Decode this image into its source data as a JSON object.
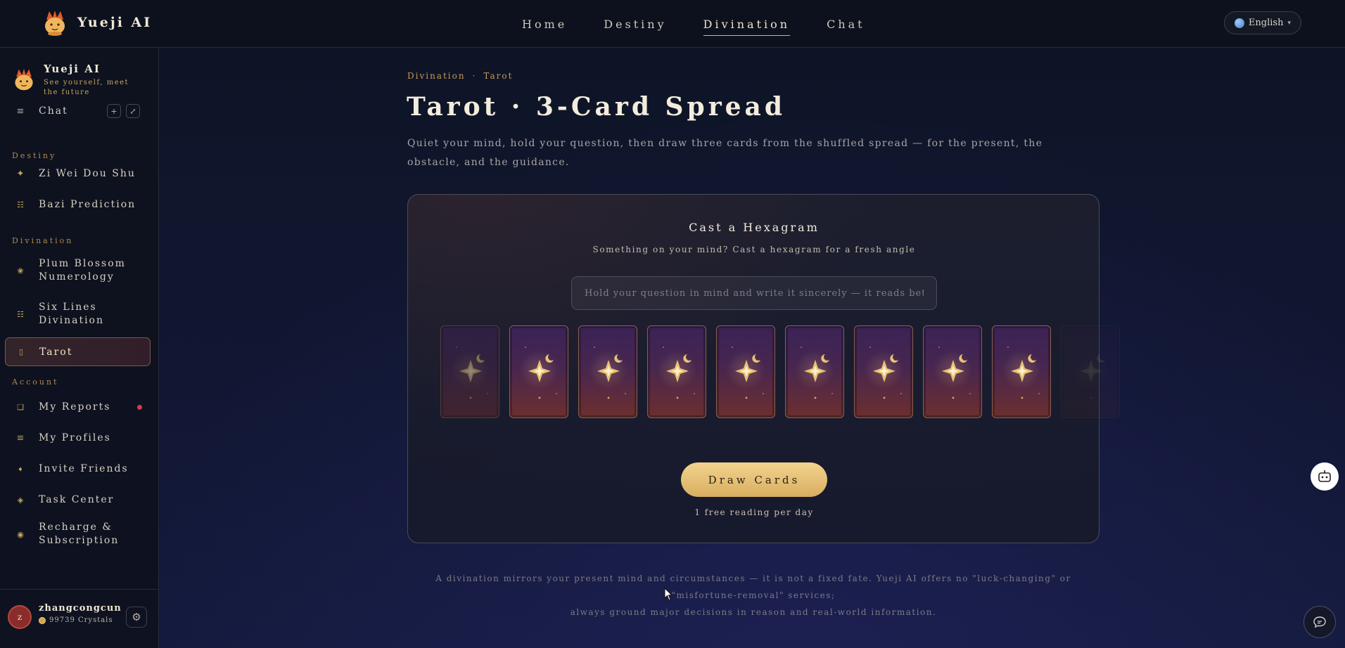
{
  "app": {
    "name": "Yueji AI",
    "tagline": "See yourself, meet the future"
  },
  "topnav": {
    "items": [
      {
        "label": "Home"
      },
      {
        "label": "Destiny"
      },
      {
        "label": "Divination"
      },
      {
        "label": "Chat"
      }
    ],
    "active": "Divination",
    "language": "English"
  },
  "sidebar": {
    "chat_label": "Chat",
    "groups": {
      "destiny": "Destiny",
      "divination": "Divination",
      "account": "Account"
    },
    "destiny_items": [
      {
        "label": "Zi Wei Dou Shu",
        "icon": "sparkle-icon"
      },
      {
        "label": "Bazi Prediction",
        "icon": "grid-icon"
      }
    ],
    "divination_items": [
      {
        "label": "Plum Blossom Numerology",
        "icon": "flower-icon"
      },
      {
        "label": "Six Lines Divination",
        "icon": "hexagram-icon"
      },
      {
        "label": "Tarot",
        "icon": "card-icon"
      }
    ],
    "account_items": [
      {
        "label": "My Reports",
        "icon": "report-icon"
      },
      {
        "label": "My Profiles",
        "icon": "list-icon"
      },
      {
        "label": "Invite Friends",
        "icon": "share-icon"
      },
      {
        "label": "Task Center",
        "icon": "diamond-icon"
      },
      {
        "label": "Recharge & Subscription",
        "icon": "coin-icon"
      }
    ],
    "user": {
      "initial": "z",
      "name": "zhangcongcun",
      "crystals": "99739 Crystals"
    }
  },
  "main": {
    "breadcrumb": [
      "Divination",
      "·",
      "Tarot"
    ],
    "title": "Tarot · 3-Card Spread",
    "description": "Quiet your mind, hold your question, then draw three cards from the shuffled spread — for the present, the obstacle, and the guidance.",
    "panel": {
      "title": "Cast a Hexagram",
      "subtitle": "Something on your mind? Cast a hexagram for a fresh angle",
      "input_placeholder": "Hold your question in mind and write it sincerely — it reads better~",
      "draw_button": "Draw Cards",
      "note": "1 free reading per day"
    },
    "disclaimer_line1": "A divination mirrors your present mind and circumstances — it is not a fixed fate. Yueji AI offers no \"luck-changing\" or \"misfortune-removal\" services;",
    "disclaimer_line2": "always ground major decisions in reason and real-world information."
  },
  "colors": {
    "accent": "#d8b56e",
    "button": "#e6c27a",
    "active_bg": "#4a2a34",
    "notify": "#d8384a"
  }
}
